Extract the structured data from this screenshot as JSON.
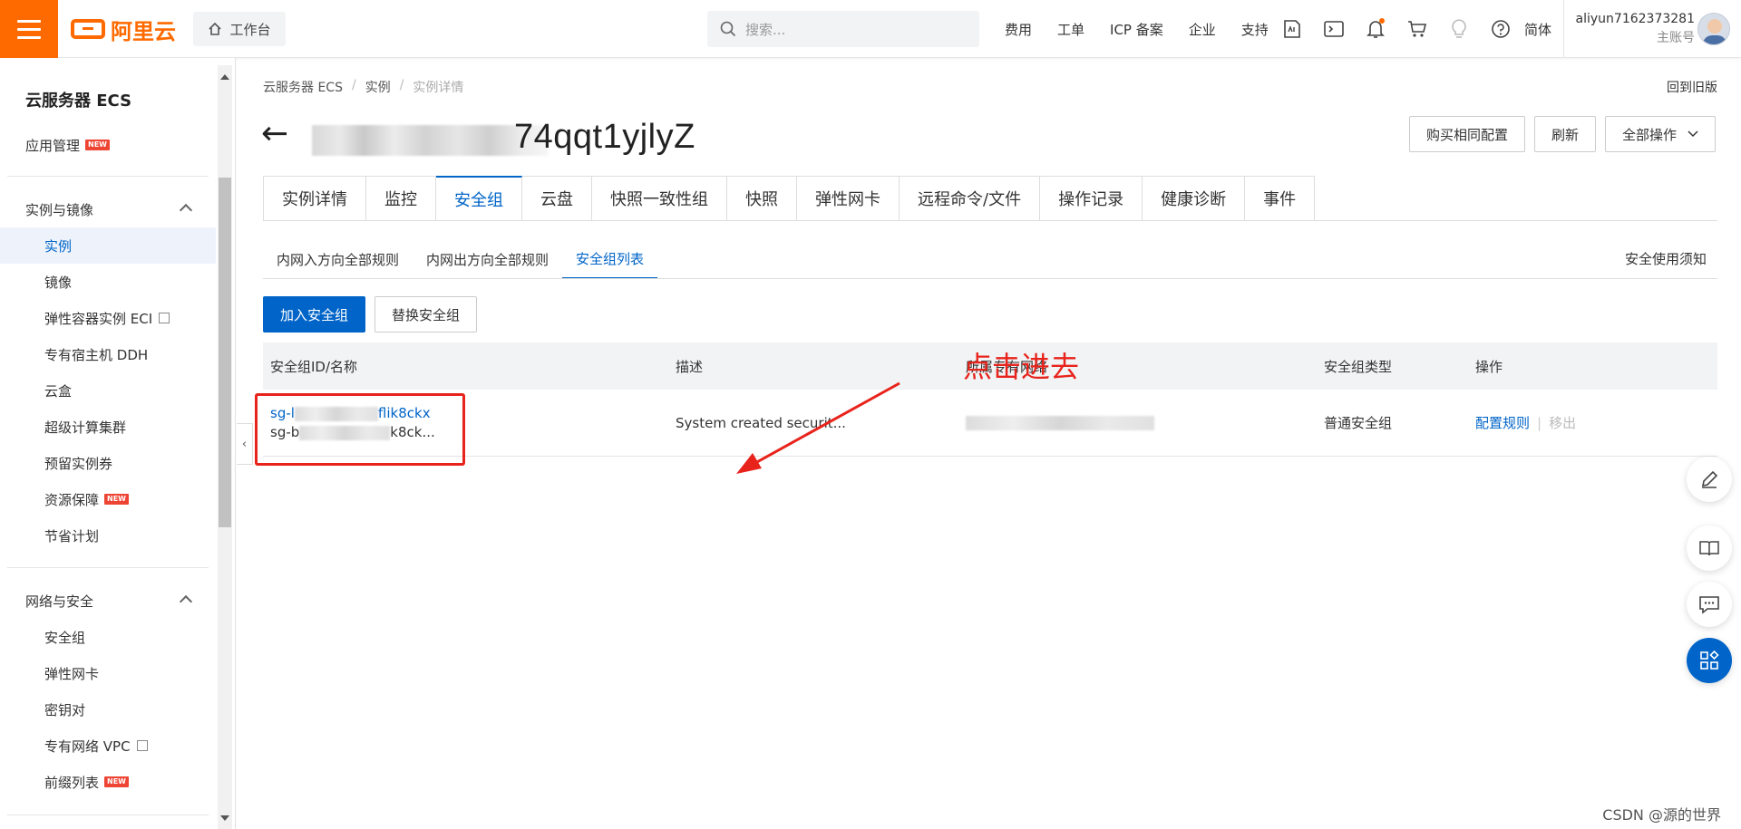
{
  "topbar": {
    "logo_text": "阿里云",
    "workbench": "工作台",
    "search_placeholder": "搜索...",
    "nav": [
      "费用",
      "工单",
      "ICP 备案",
      "企业",
      "支持"
    ],
    "lang": "简体",
    "username": "aliyun7162373281",
    "account_type": "主账号",
    "accent": "#ff6a00"
  },
  "sidebar": {
    "title": "云服务器 ECS",
    "items": [
      {
        "label": "应用管理",
        "badge": "NEW"
      },
      {
        "label": "实例与镜像"
      },
      {
        "label": "实例"
      },
      {
        "label": "镜像"
      },
      {
        "label": "弹性容器实例 ECI"
      },
      {
        "label": "专有宿主机 DDH"
      },
      {
        "label": "云盒"
      },
      {
        "label": "超级计算集群"
      },
      {
        "label": "预留实例券"
      },
      {
        "label": "资源保障",
        "badge": "NEW"
      },
      {
        "label": "节省计划"
      },
      {
        "label": "网络与安全"
      },
      {
        "label": "安全组"
      },
      {
        "label": "弹性网卡"
      },
      {
        "label": "密钥对"
      },
      {
        "label": "专有网络 VPC"
      },
      {
        "label": "前缀列表",
        "badge": "NEW"
      }
    ]
  },
  "main": {
    "breadcrumb": [
      "云服务器 ECS",
      "实例",
      "实例详情"
    ],
    "old_version": "回到旧版",
    "instance_id_suffix": "74qqt1yjlyZ",
    "buttons": {
      "buy_same": "购买相同配置",
      "refresh": "刷新",
      "all_ops": "全部操作"
    },
    "tabs": [
      "实例详情",
      "监控",
      "安全组",
      "云盘",
      "快照一致性组",
      "快照",
      "弹性网卡",
      "远程命令/文件",
      "操作记录",
      "健康诊断",
      "事件"
    ],
    "subtabs": [
      "内网入方向全部规则",
      "内网出方向全部规则",
      "安全组列表"
    ],
    "security_notice": "安全使用须知",
    "actions": {
      "join": "加入安全组",
      "replace": "替换安全组"
    },
    "annotation": "点击进去",
    "table": {
      "headers": [
        "安全组ID/名称",
        "描述",
        "所属专有网络",
        "安全组类型",
        "操作"
      ],
      "row": {
        "id_prefix": "sg-l",
        "id_suffix": "flik8ckx",
        "name_prefix": "sg-b",
        "name_suffix": "k8ck...",
        "description": "System created securit...",
        "type": "普通安全组",
        "op_config": "配置规则",
        "op_remove": "移出"
      }
    }
  },
  "watermark": "CSDN @源的世界"
}
